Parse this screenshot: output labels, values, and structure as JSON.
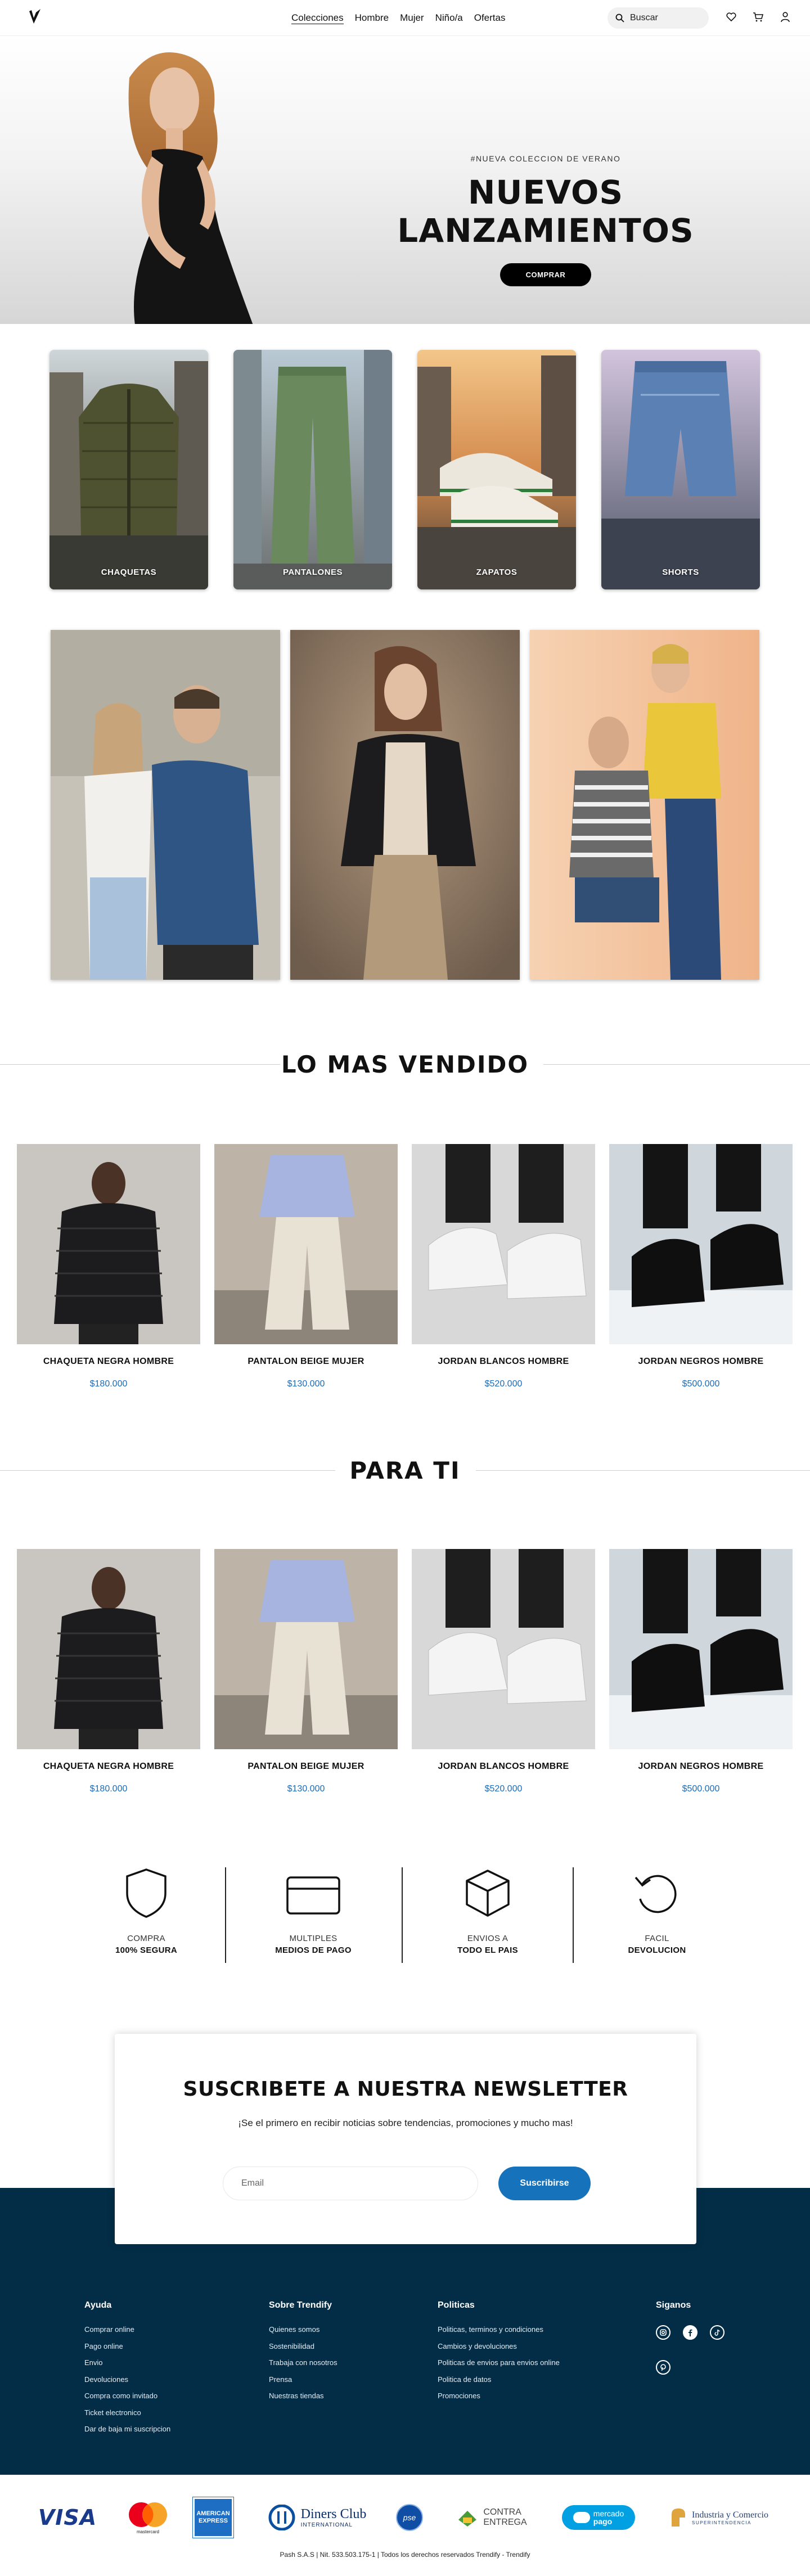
{
  "nav": {
    "logo": "trendify-logo",
    "menu": [
      "Colecciones",
      "Hombre",
      "Mujer",
      "Niño/a",
      "Ofertas"
    ],
    "search_placeholder": "Buscar",
    "icons": [
      "heart-icon",
      "cart-icon",
      "user-icon"
    ]
  },
  "hero": {
    "eyebrow": "#NUEVA COLECCION DE VERANO",
    "title": "NUEVOS LANZAMIENTOS",
    "cta": "COMPRAR"
  },
  "categories": [
    {
      "label": "CHAQUETAS"
    },
    {
      "label": "PANTALONES"
    },
    {
      "label": "ZAPATOS"
    },
    {
      "label": "SHORTS"
    }
  ],
  "best_sellers": {
    "title": "LO MAS VENDIDO",
    "products": [
      {
        "name": "CHAQUETA NEGRA HOMBRE",
        "price": "$180.000"
      },
      {
        "name": "PANTALON BEIGE MUJER",
        "price": "$130.000"
      },
      {
        "name": "JORDAN BLANCOS HOMBRE",
        "price": "$520.000"
      },
      {
        "name": "JORDAN NEGROS HOMBRE",
        "price": "$500.000"
      }
    ]
  },
  "for_you": {
    "title": "PARA TI",
    "products": [
      {
        "name": "CHAQUETA NEGRA HOMBRE",
        "price": "$180.000"
      },
      {
        "name": "PANTALON BEIGE MUJER",
        "price": "$130.000"
      },
      {
        "name": "JORDAN BLANCOS HOMBRE",
        "price": "$520.000"
      },
      {
        "name": "JORDAN NEGROS HOMBRE",
        "price": "$500.000"
      }
    ]
  },
  "features": [
    {
      "line1": "COMPRA",
      "line2": "100% SEGURA",
      "icon": "shield-icon"
    },
    {
      "line1": "MULTIPLES",
      "line2": "MEDIOS DE PAGO",
      "icon": "credit-card-icon"
    },
    {
      "line1": "ENVIOS A",
      "line2": "TODO EL PAIS",
      "icon": "box-icon"
    },
    {
      "line1": "FACIL",
      "line2": "DEVOLUCION",
      "icon": "return-icon"
    }
  ],
  "newsletter": {
    "title": "SUSCRIBETE A NUESTRA NEWSLETTER",
    "subtitle": "¡Se el primero en recibir noticias sobre tendencias, promociones y mucho mas!",
    "email_placeholder": "Email",
    "button": "Suscribirse"
  },
  "footer": {
    "help": {
      "title": "Ayuda",
      "links": [
        "Comprar online",
        "Pago online",
        "Envio",
        "Devoluciones",
        "Compra como invitado",
        "Ticket electronico",
        "Dar de baja mi suscripcion"
      ]
    },
    "about": {
      "title": "Sobre Trendify",
      "links": [
        "Quienes somos",
        "Sostenibilidad",
        "Trabaja con nosotros",
        "Prensa",
        "Nuestras tiendas"
      ]
    },
    "policies": {
      "title": "Politicas",
      "links": [
        "Politicas, terminos y condiciones",
        "Cambios y devoluciones",
        "Politicas de envios para envios online",
        "Politica de datos",
        "Promociones"
      ]
    },
    "social": {
      "title": "Siganos",
      "icons": [
        "instagram-icon",
        "facebook-icon",
        "tiktok-icon",
        "pinterest-icon"
      ]
    }
  },
  "payments": {
    "visa": "VISA",
    "mastercard": "mastercard",
    "amex": "AMERICAN EXPRESS",
    "diners": "Diners Club",
    "diners_sub": "INTERNATIONAL",
    "pse": "pse",
    "contra1": "CONTRA",
    "contra2": "ENTREGA",
    "mercado1": "mercado",
    "mercado2": "pago",
    "sic1": "Industria y Comercio",
    "sic2": "SUPERINTENDENCIA",
    "legal": "Pash S.A.S | Nit. 533.503.175-1 | Todos los derechos reservados Trendify - Trendify"
  },
  "colors": {
    "accent": "#1672ba",
    "footer": "#032d46",
    "price": "#1b6bb8"
  }
}
